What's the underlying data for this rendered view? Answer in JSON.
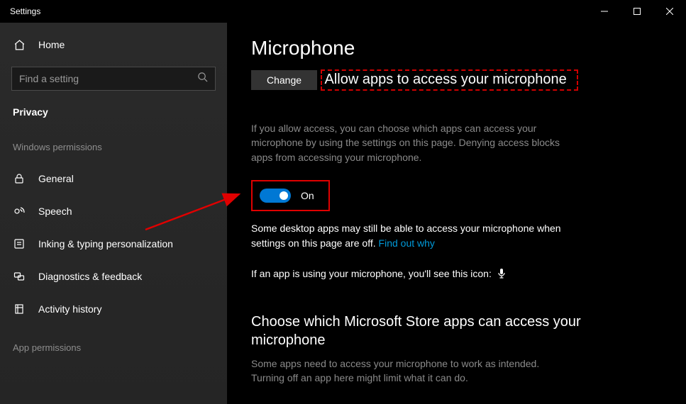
{
  "window": {
    "title": "Settings"
  },
  "sidebar": {
    "home_label": "Home",
    "search_placeholder": "Find a setting",
    "category": "Privacy",
    "section1": "Windows permissions",
    "items": [
      {
        "label": "General"
      },
      {
        "label": "Speech"
      },
      {
        "label": "Inking & typing personalization"
      },
      {
        "label": "Diagnostics & feedback"
      },
      {
        "label": "Activity history"
      }
    ],
    "section2": "App permissions"
  },
  "content": {
    "title": "Microphone",
    "change_button": "Change",
    "allow_heading": "Allow apps to access your microphone",
    "allow_body": "If you allow access, you can choose which apps can access your microphone by using the settings on this page. Denying access blocks apps from accessing your microphone.",
    "toggle_state": "On",
    "desktop_line": "Some desktop apps may still be able to access your microphone when settings on this page are off. ",
    "find_out_why": "Find out why",
    "using_line": "If an app is using your microphone, you'll see this icon:",
    "store_heading": "Choose which Microsoft Store apps can access your microphone",
    "store_body": "Some apps need to access your microphone to work as intended. Turning off an app here might limit what it can do."
  }
}
